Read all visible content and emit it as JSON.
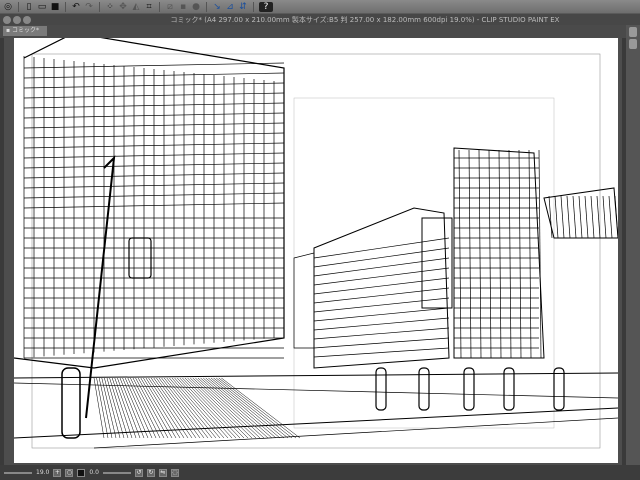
{
  "toolbar": {
    "icons": [
      "clip-studio-logo",
      "new-file",
      "open-file",
      "save",
      "undo",
      "redo",
      "transform",
      "move",
      "fill",
      "crop",
      "snap-ruler",
      "snap-special-ruler",
      "snap-grid",
      "help"
    ]
  },
  "window": {
    "title": "コミック* (A4 297.00 x 210.00mm 製本サイズ:B5 判 257.00 x 182.00mm 600dpi 19.0%)  - CLIP STUDIO PAINT EX"
  },
  "tab": {
    "label": "コミック*"
  },
  "status": {
    "zoom": "19.0",
    "angle": "0.0"
  }
}
